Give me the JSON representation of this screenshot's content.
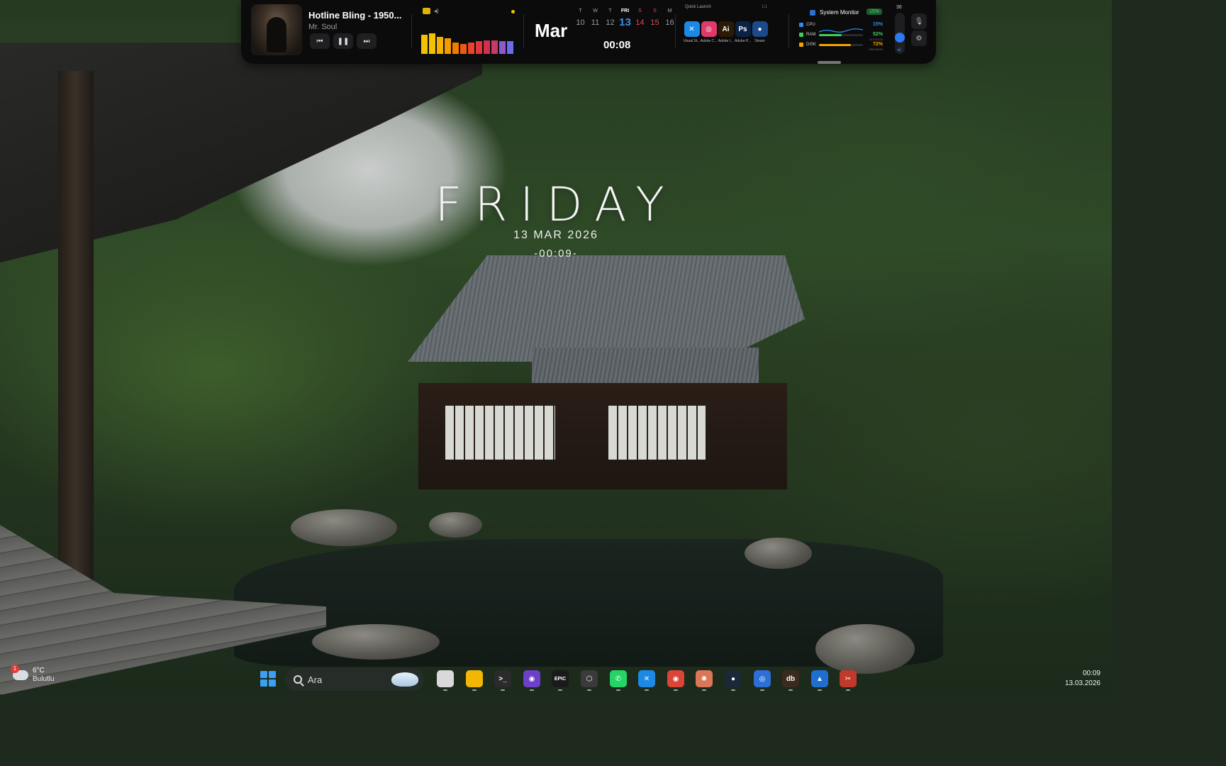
{
  "media": {
    "title": "Hotline Bling - 1950...",
    "artist": "Mr. Soul",
    "prev_icon": "skip-previous-icon",
    "play_pause_icon": "pause-icon",
    "next_icon": "skip-next-icon",
    "visualizer_levels": [
      0.85,
      0.9,
      0.75,
      0.7,
      0.5,
      0.45,
      0.5,
      0.55,
      0.6,
      0.6,
      0.55,
      0.55
    ],
    "visualizer_colors": [
      "#f2c200",
      "#f2c200",
      "#f2b300",
      "#f29b00",
      "#f07d00",
      "#ee5a14",
      "#e9442a",
      "#e0363c",
      "#d2304e",
      "#c43a68",
      "#8c5ad0",
      "#6a6ee8"
    ]
  },
  "calendar": {
    "month": "Mar",
    "days": [
      {
        "dow": "T",
        "day": "10",
        "today": false,
        "weekend": false
      },
      {
        "dow": "W",
        "day": "11",
        "today": false,
        "weekend": false
      },
      {
        "dow": "T",
        "day": "12",
        "today": false,
        "weekend": false
      },
      {
        "dow": "FRI",
        "day": "13",
        "today": true,
        "weekend": false
      },
      {
        "dow": "S",
        "day": "14",
        "today": false,
        "weekend": true
      },
      {
        "dow": "S",
        "day": "15",
        "today": false,
        "weekend": true
      },
      {
        "dow": "M",
        "day": "16",
        "today": false,
        "weekend": false
      }
    ],
    "time": "00:08"
  },
  "quick_launch": {
    "title": "Quick Launch",
    "page": "1/1",
    "apps": [
      {
        "label": "Visual St...",
        "icon": "vscode-icon",
        "glyph": "✕",
        "color": "#1e88e5"
      },
      {
        "label": "Adobe C...",
        "icon": "adobe-cc-icon",
        "glyph": "◎",
        "color": "#e03a6a"
      },
      {
        "label": "Adobe I...",
        "icon": "illustrator-icon",
        "glyph": "Ai",
        "color": "#2b1a06"
      },
      {
        "label": "Adobe P...",
        "icon": "photoshop-icon",
        "glyph": "Ps",
        "color": "#0b2246"
      },
      {
        "label": "Steam",
        "icon": "steam-icon",
        "glyph": "●",
        "color": "#1b4a8a"
      }
    ]
  },
  "system_monitor": {
    "title": "System Monitor",
    "badge": "15%",
    "rows": [
      {
        "label": "CPU",
        "value": "15%",
        "sub": "",
        "color": "#2d8ef0",
        "level": 0.15
      },
      {
        "label": "RAM",
        "value": "52%",
        "sub": "16.0/31GB",
        "color": "#3ecf5a",
        "level": 0.52
      },
      {
        "label": "DISK",
        "value": "72%",
        "sub": "MB/656GB",
        "color": "#f5a300",
        "level": 0.72
      }
    ]
  },
  "volume": {
    "value": "36",
    "level": 0.36,
    "icon": "speaker-icon",
    "mic_icon": "microphone-muted-icon",
    "settings_icon": "gear-icon"
  },
  "desktop_clock": {
    "day": "FRIDAY",
    "date": "13 MAR 2026",
    "time": "-00:09-"
  },
  "taskbar": {
    "weather": {
      "temp": "6°C",
      "condition": "Bulutlu",
      "badge": "1",
      "icon": "cloud-icon"
    },
    "start_icon": "windows-start-icon",
    "search_placeholder": "Ara",
    "search_icon": "search-icon",
    "apps": [
      {
        "icon": "widgets-icon",
        "glyph": "",
        "color": "#d9d9d9"
      },
      {
        "icon": "file-explorer-icon",
        "glyph": "",
        "color": "#f2b705"
      },
      {
        "icon": "terminal-icon",
        "glyph": ">_",
        "color": "#2b2b2b"
      },
      {
        "icon": "github-icon",
        "glyph": "◉",
        "color": "#6e40c9"
      },
      {
        "icon": "epic-games-icon",
        "glyph": "EPIC",
        "color": "#1a1a1a"
      },
      {
        "icon": "unity-icon",
        "glyph": "⬡",
        "color": "#3a3a3a"
      },
      {
        "icon": "whatsapp-icon",
        "glyph": "✆",
        "color": "#25d366"
      },
      {
        "icon": "vscode-icon",
        "glyph": "✕",
        "color": "#1e88e5"
      },
      {
        "icon": "chrome-icon",
        "glyph": "◉",
        "color": "#db4437"
      },
      {
        "icon": "claude-icon",
        "glyph": "✺",
        "color": "#d97757"
      },
      {
        "icon": "steam-icon",
        "glyph": "●",
        "color": "#1b2838"
      },
      {
        "icon": "settings-app-icon",
        "glyph": "◎",
        "color": "#2d6fd6"
      },
      {
        "icon": "dbeaver-icon",
        "glyph": "db",
        "color": "#3a2a20"
      },
      {
        "icon": "photos-icon",
        "glyph": "▲",
        "color": "#1e6fd0"
      },
      {
        "icon": "snipping-tool-icon",
        "glyph": "✂",
        "color": "#c0392b"
      }
    ],
    "clock_time": "00:09",
    "clock_date": "13.03.2026"
  }
}
